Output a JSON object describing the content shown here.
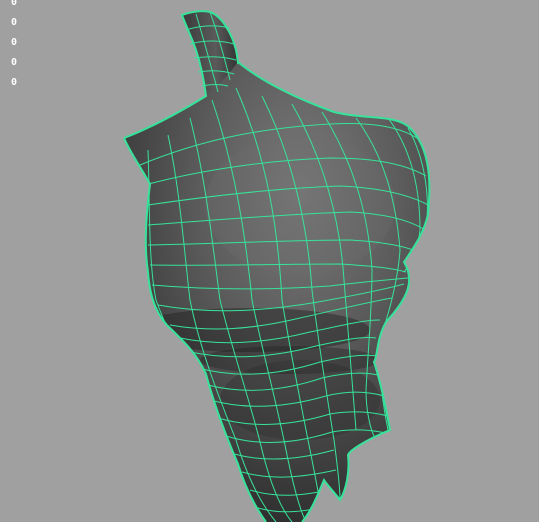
{
  "viewport": {
    "background": "#a0a0a0",
    "hud_values": [
      "0",
      "0",
      "0",
      "0",
      "0"
    ]
  },
  "model": {
    "wireframe_color": "#37e39a",
    "selected": true
  }
}
